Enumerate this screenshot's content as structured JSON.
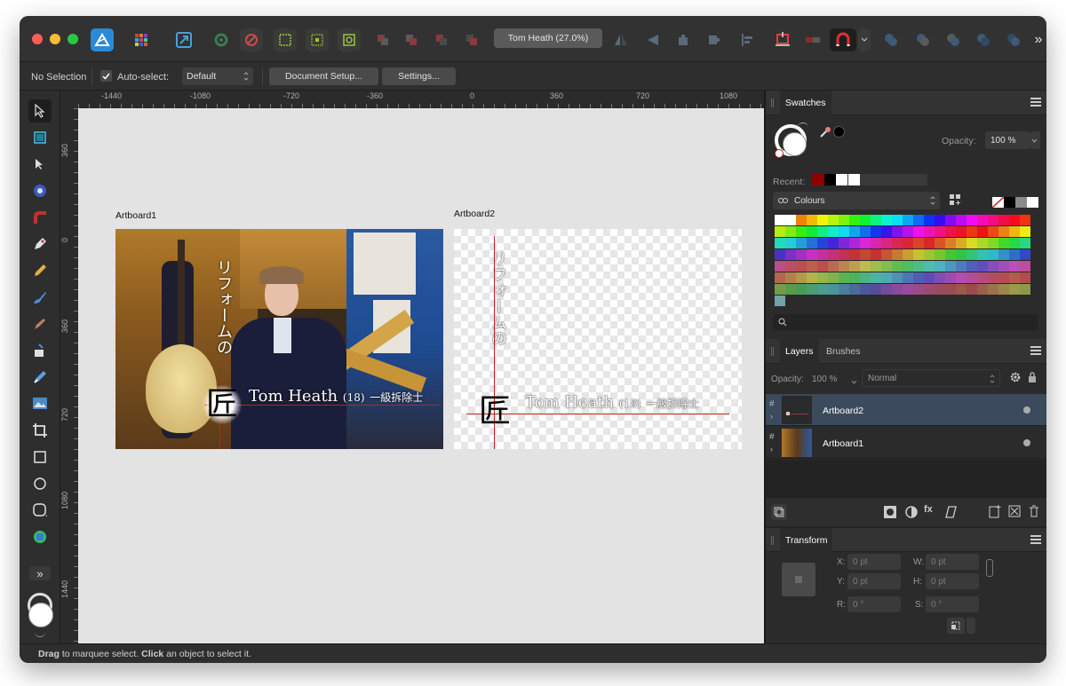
{
  "window": {
    "title": "Tom Heath (27.0%)",
    "traffic_lights": [
      "#fe5f57",
      "#febc2e",
      "#28c840"
    ]
  },
  "toolbar": {
    "doc_title": "Tom Heath (27.0%)",
    "overflow_label": "»"
  },
  "context": {
    "selection": "No Selection",
    "autoselect_label": "Auto-select:",
    "autoselect_value": "Default",
    "document_setup": "Document Setup...",
    "settings": "Settings..."
  },
  "ruler": {
    "unit": "pt",
    "h_ticks": [
      "-1440",
      "-1080",
      "-720",
      "-360",
      "0",
      "360",
      "720",
      "1080"
    ],
    "v_ticks": [
      "360",
      "0",
      "360",
      "720",
      "1080",
      "1440"
    ]
  },
  "artboard1": {
    "label": "Artboard1",
    "vertical_text": "リフォームの",
    "kanji": "匠",
    "name": "Tom Heath",
    "age": "(18)",
    "title": "一級拆除士"
  },
  "artboard2": {
    "label": "Artboard2",
    "vertical_text": "リフォームの",
    "kanji": "匠",
    "name": "Tom Heath",
    "age": "(18)",
    "title": "一級拆除士"
  },
  "swatches": {
    "tab": "Swatches",
    "opacity_label": "Opacity:",
    "opacity_value": "100 %",
    "recent_label": "Recent:",
    "palette_label": "Colours",
    "recent_colors": [
      "#8b0000",
      "#000000",
      "#ffffff",
      "#ffffff"
    ]
  },
  "layers": {
    "tabs": [
      "Layers",
      "Brushes"
    ],
    "opacity_label": "Opacity:",
    "opacity_value": "100 %",
    "blend_mode": "Normal",
    "items": [
      {
        "name": "Artboard2",
        "selected": true
      },
      {
        "name": "Artboard1",
        "selected": false
      }
    ]
  },
  "transform": {
    "tab": "Transform",
    "x_label": "X:",
    "x_value": "0 pt",
    "y_label": "Y:",
    "y_value": "0 pt",
    "w_label": "W:",
    "w_value": "0 pt",
    "h_label": "H:",
    "h_value": "0 pt",
    "r_label": "R:",
    "r_value": "0 °",
    "s_label": "S:",
    "s_value": "0 °"
  },
  "status": {
    "drag": "Drag",
    "drag_text": " to marquee select. ",
    "click": "Click",
    "click_text": " an object to select it."
  },
  "accent": "#2a8ad8",
  "selected_row_color": "#3b4a5c"
}
